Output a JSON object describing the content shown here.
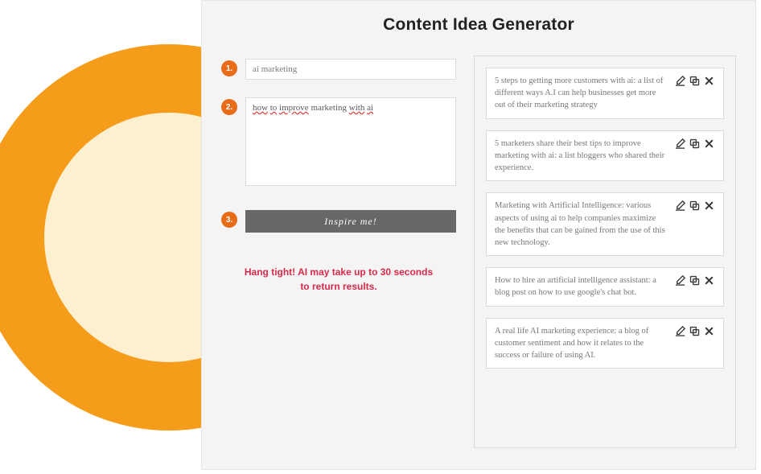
{
  "title": "Content Idea Generator",
  "steps": {
    "s1": {
      "badge": "1.",
      "value": "ai marketing"
    },
    "s2": {
      "badge": "2.",
      "value_html": "how to improve marketing with ai"
    },
    "s3": {
      "badge": "3.",
      "button": "Inspire me!"
    }
  },
  "status": "Hang tight! AI may take up to 30 seconds to return results.",
  "results": [
    "5 steps to getting more customers with ai: a list of different ways A.I can help businesses get more out of their marketing strategy",
    "5 marketers share their best tips to improve marketing with ai: a list bloggers who shared their experience.",
    "Marketing with Artificial Intelligence: various aspects of using ai to help companies maximize the benefits that can be gained from the use of this new technology.",
    "How to hire an artificial intelligence assistant: a blog post on how to use google's chat bot.",
    "A real life AI marketing experience: a blog of customer sentiment and how it relates to the success or failure of using AI."
  ]
}
